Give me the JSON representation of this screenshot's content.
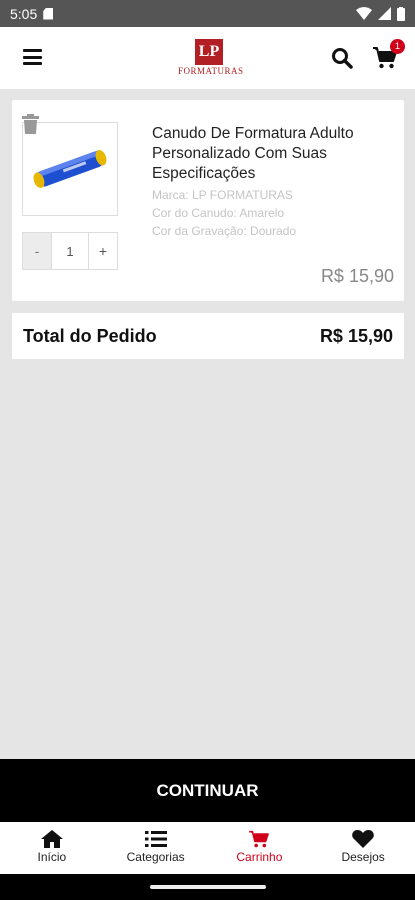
{
  "status_bar": {
    "time": "5:05"
  },
  "header": {
    "logo_mark": "LP",
    "logo_text": "FORMATURAS",
    "cart_count": "1"
  },
  "cart_item": {
    "name": "Canudo De Formatura Adulto Personalizado Com Suas Especificações",
    "attributes": [
      "Marca: LP FORMATURAS",
      "Cor do Canudo: Amarelo",
      "Cor da Gravação: Dourado"
    ],
    "quantity": "1",
    "minus_label": "-",
    "plus_label": "+",
    "price": "R$  15,90"
  },
  "order_total": {
    "label": "Total do Pedido",
    "value": "R$  15,90"
  },
  "continue_label": "CONTINUAR",
  "bottom_nav": [
    {
      "label": "Início",
      "icon": "home-icon"
    },
    {
      "label": "Categorias",
      "icon": "list-icon"
    },
    {
      "label": "Carrinho",
      "icon": "cart-icon",
      "active": true
    },
    {
      "label": "Desejos",
      "icon": "heart-icon"
    }
  ],
  "colors": {
    "accent": "#d0021b",
    "brand": "#b21f24"
  }
}
